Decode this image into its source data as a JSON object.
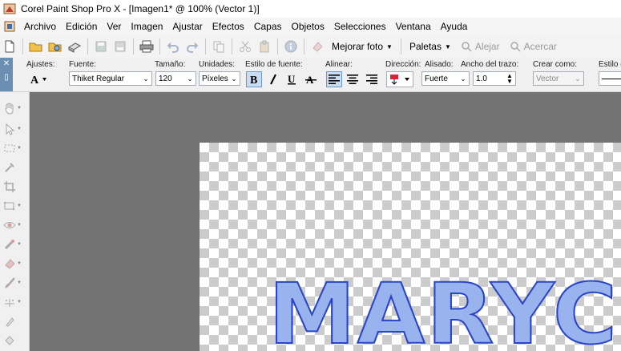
{
  "window": {
    "title": "Corel Paint Shop Pro X - [Imagen1* @ 100% (Vector 1)]"
  },
  "menu": [
    "Archivo",
    "Edición",
    "Ver",
    "Imagen",
    "Ajustar",
    "Efectos",
    "Capas",
    "Objetos",
    "Selecciones",
    "Ventana",
    "Ayuda"
  ],
  "toolbar": {
    "enhance_label": "Mejorar foto",
    "palettes_label": "Paletas",
    "zoom_out_label": "Alejar",
    "zoom_in_label": "Acercar"
  },
  "tool_options": {
    "presets_label": "Ajustes:",
    "font_label": "Fuente:",
    "font_value": "Thiket Regular",
    "size_label": "Tamaño:",
    "size_value": "120",
    "units_label": "Unidades:",
    "units_value": "Píxeles",
    "style_label": "Estilo de fuente:",
    "align_label": "Alinear:",
    "direction_label": "Dirección:",
    "antialias_label": "Alisado:",
    "antialias_value": "Fuerte",
    "stroke_label": "Ancho del trazo:",
    "stroke_value": "1.0",
    "create_label": "Crear como:",
    "create_value": "Vector",
    "line_style_label": "Estilo d"
  },
  "canvas": {
    "text": "MARYCIN"
  },
  "colors": {
    "vector_fill": "#99b3ee",
    "vector_stroke": "#2a45c8",
    "workspace": "#737373"
  }
}
